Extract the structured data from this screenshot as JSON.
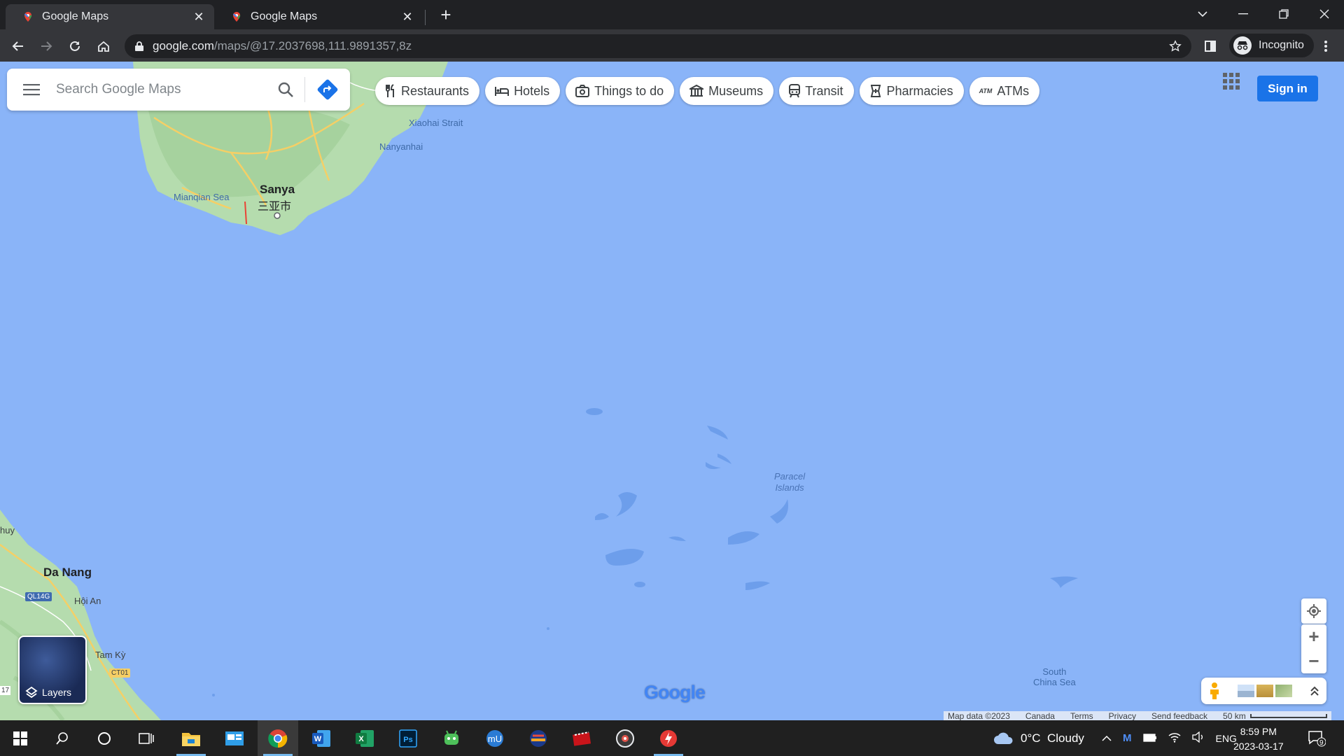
{
  "browser": {
    "tabs": [
      {
        "title": "Google Maps",
        "active": true
      },
      {
        "title": "Google Maps",
        "active": false
      }
    ],
    "url_host": "google.com",
    "url_path": "/maps/@17.2037698,111.9891357,8z",
    "profile_label": "Incognito"
  },
  "maps": {
    "search_placeholder": "Search Google Maps",
    "chips": [
      {
        "label": "Restaurants",
        "icon": "fork-knife-icon"
      },
      {
        "label": "Hotels",
        "icon": "bed-icon"
      },
      {
        "label": "Things to do",
        "icon": "camera-icon"
      },
      {
        "label": "Museums",
        "icon": "museum-icon"
      },
      {
        "label": "Transit",
        "icon": "train-icon"
      },
      {
        "label": "Pharmacies",
        "icon": "pharmacy-icon"
      },
      {
        "label": "ATMs",
        "icon": "atm-icon"
      }
    ],
    "sign_in": "Sign in",
    "layers_label": "Layers",
    "labels": {
      "sanya": "Sanya",
      "sanya_cn": "三亚市",
      "mianqian_sea": "Mianqian Sea",
      "xiaohai_strait": "Xiaohai Strait",
      "nanyanhai": "Nanyanhai",
      "paracel": "Paracel\nIslands",
      "paracel_1": "Paracel",
      "paracel_2": "Islands",
      "da_nang": "Da Nang",
      "hoi_an": "Hội An",
      "tam_ky": "Tam Kỳ",
      "road_ql14g": "QL14G",
      "road_ct01": "CT01",
      "huy": "huy",
      "south_china_sea_1": "South",
      "south_china_sea_2": "China Sea",
      "edge_17": "17"
    },
    "logo_text": "Google",
    "footer": {
      "map_data": "Map data ©2023",
      "country": "Canada",
      "terms": "Terms",
      "privacy": "Privacy",
      "feedback": "Send feedback",
      "scale": "50 km"
    },
    "colors": {
      "water": "#8ab4f8",
      "land": "#aadaa0",
      "accent": "#1a73e8"
    }
  },
  "taskbar": {
    "weather": "0°C  Cloudy",
    "language": "ENG",
    "time": "8:59 PM",
    "date": "2023-03-17",
    "notifications": "9"
  }
}
